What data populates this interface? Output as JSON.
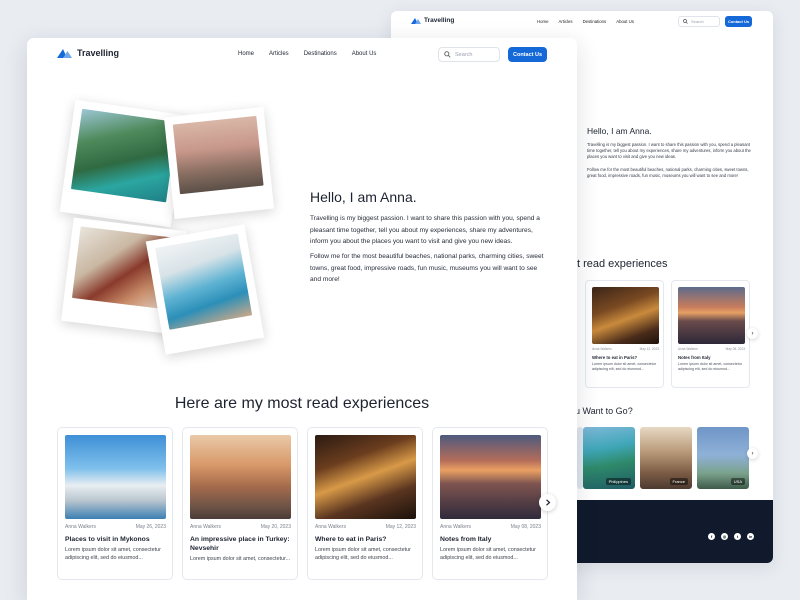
{
  "brand": {
    "name": "Travelling",
    "accent": "#1468d8"
  },
  "nav": {
    "links": [
      "Home",
      "Articles",
      "Destinations",
      "About Us"
    ],
    "search_placeholder": "Search",
    "cta": "Contact Us"
  },
  "hero": {
    "title": "Hello, I am Anna.",
    "paragraph1": "Travelling is my biggest passion. I want to share this passion with you, spend a pleasant time together, tell you about my experiences, share my adventures, inform you about the places you want to visit and give you new ideas.",
    "paragraph2": "Follow me for the most beautiful beaches, national parks, charming cities, sweet towns, great food, impressive roads, fun music, museums you will want to see and more!"
  },
  "experiences": {
    "title": "Here are my most read experiences",
    "cards": [
      {
        "author": "Anna Walkers",
        "date": "May 26, 2023",
        "title": "Places to visit in Mykonos",
        "desc": "Lorem ipsum dolor sit amet, consectetur adipiscing elit, sed do eiusmod..."
      },
      {
        "author": "Anna Walkers",
        "date": "May 20, 2023",
        "title": "An impressive place in Turkey: Nevsehir",
        "desc": "Lorem ipsum dolor sit amet, consectetur..."
      },
      {
        "author": "Anna Walkers",
        "date": "May 12, 2023",
        "title": "Where to eat in Paris?",
        "desc": "Lorem ipsum dolor sit amet, consectetur adipiscing elit, sed do eiusmod..."
      },
      {
        "author": "Anna Walkers",
        "date": "May 08, 2023",
        "title": "Notes from Italy",
        "desc": "Lorem ipsum dolor sit amet, consectetur adipiscing elit, sed do eiusmod..."
      }
    ],
    "next_icon": "chevron-right-icon"
  },
  "back_window": {
    "section1_title": "t read experiences",
    "section2_title": "u Want to Go?",
    "destinations": [
      "Philippines",
      "France",
      "USA"
    ],
    "social": [
      "f",
      "◎",
      "t",
      "in"
    ]
  }
}
